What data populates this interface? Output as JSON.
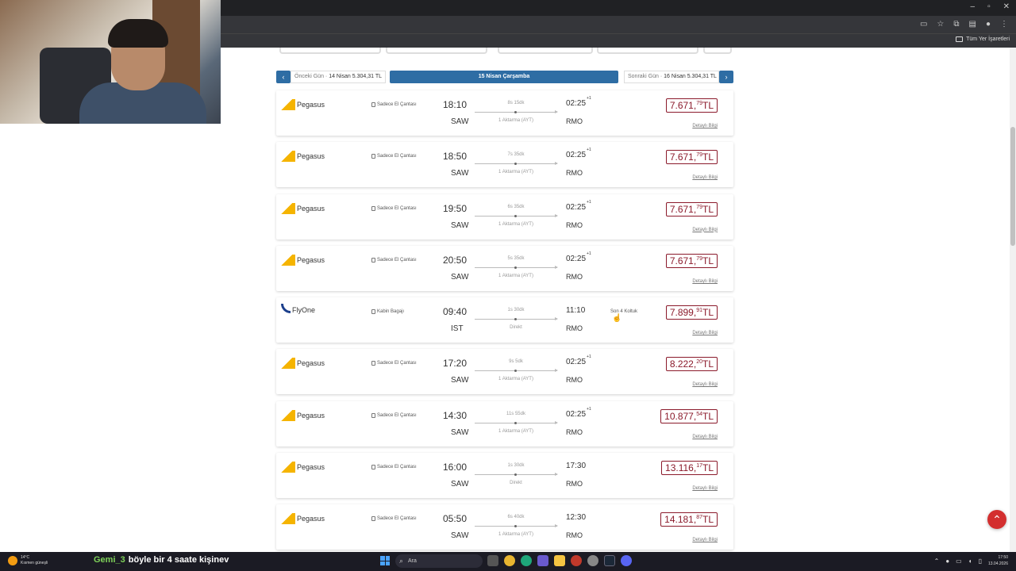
{
  "browser": {
    "bookmarks_all_label": "Tüm Yer İşaretleri"
  },
  "date_nav": {
    "prev_label": "Önceki Gün · ",
    "prev_value": "14 Nisan 5.304,31 TL",
    "current": "15 Nisan Çarşamba",
    "next_label": "Sonraki Gün · ",
    "next_value": "16 Nisan 5.304,31 TL",
    "prev_arrow": "‹",
    "next_arrow": "›"
  },
  "flights": [
    {
      "airline": "Pegasus",
      "logo": "pegasus-logo",
      "baggage": "Sadece El Çantası",
      "dep_time": "18:10",
      "dep_airport": "SAW",
      "duration": "8s 15dk",
      "stops": "1 Aktarma (AYT)",
      "arr_time": "02:25",
      "arr_plus": "+1",
      "arr_airport": "RMO",
      "seats": "",
      "price_main": "7.671,",
      "price_cents": "79",
      "currency": "TL",
      "details": "Detaylı Bilgi"
    },
    {
      "airline": "Pegasus",
      "logo": "pegasus-logo",
      "baggage": "Sadece El Çantası",
      "dep_time": "18:50",
      "dep_airport": "SAW",
      "duration": "7s 35dk",
      "stops": "1 Aktarma (AYT)",
      "arr_time": "02:25",
      "arr_plus": "+1",
      "arr_airport": "RMO",
      "seats": "",
      "price_main": "7.671,",
      "price_cents": "79",
      "currency": "TL",
      "details": "Detaylı Bilgi"
    },
    {
      "airline": "Pegasus",
      "logo": "pegasus-logo",
      "baggage": "Sadece El Çantası",
      "dep_time": "19:50",
      "dep_airport": "SAW",
      "duration": "6s 35dk",
      "stops": "1 Aktarma (AYT)",
      "arr_time": "02:25",
      "arr_plus": "+1",
      "arr_airport": "RMO",
      "seats": "",
      "price_main": "7.671,",
      "price_cents": "79",
      "currency": "TL",
      "details": "Detaylı Bilgi"
    },
    {
      "airline": "Pegasus",
      "logo": "pegasus-logo",
      "baggage": "Sadece El Çantası",
      "dep_time": "20:50",
      "dep_airport": "SAW",
      "duration": "5s 35dk",
      "stops": "1 Aktarma (AYT)",
      "arr_time": "02:25",
      "arr_plus": "+1",
      "arr_airport": "RMO",
      "seats": "",
      "price_main": "7.671,",
      "price_cents": "79",
      "currency": "TL",
      "details": "Detaylı Bilgi"
    },
    {
      "airline": "FlyOne",
      "logo": "flyone-logo",
      "baggage": "Kabin Bagajı",
      "dep_time": "09:40",
      "dep_airport": "IST",
      "duration": "1s 30dk",
      "stops": "Direkt",
      "arr_time": "11:10",
      "arr_plus": "",
      "arr_airport": "RMO",
      "seats": "Son 4 Koltuk",
      "price_main": "7.899,",
      "price_cents": "91",
      "currency": "TL",
      "details": "Detaylı Bilgi"
    },
    {
      "airline": "Pegasus",
      "logo": "pegasus-logo",
      "baggage": "Sadece El Çantası",
      "dep_time": "17:20",
      "dep_airport": "SAW",
      "duration": "9s 5dk",
      "stops": "1 Aktarma (AYT)",
      "arr_time": "02:25",
      "arr_plus": "+1",
      "arr_airport": "RMO",
      "seats": "",
      "price_main": "8.222,",
      "price_cents": "20",
      "currency": "TL",
      "details": "Detaylı Bilgi"
    },
    {
      "airline": "Pegasus",
      "logo": "pegasus-logo",
      "baggage": "Sadece El Çantası",
      "dep_time": "14:30",
      "dep_airport": "SAW",
      "duration": "11s 55dk",
      "stops": "1 Aktarma (AYT)",
      "arr_time": "02:25",
      "arr_plus": "+1",
      "arr_airport": "RMO",
      "seats": "",
      "price_main": "10.877,",
      "price_cents": "54",
      "currency": "TL",
      "details": "Detaylı Bilgi"
    },
    {
      "airline": "Pegasus",
      "logo": "pegasus-logo",
      "baggage": "Sadece El Çantası",
      "dep_time": "16:00",
      "dep_airport": "SAW",
      "duration": "1s 30dk",
      "stops": "Direkt",
      "arr_time": "17:30",
      "arr_plus": "",
      "arr_airport": "RMO",
      "seats": "",
      "price_main": "13.116,",
      "price_cents": "17",
      "currency": "TL",
      "details": "Detaylı Bilgi"
    },
    {
      "airline": "Pegasus",
      "logo": "pegasus-logo",
      "baggage": "Sadece El Çantası",
      "dep_time": "05:50",
      "dep_airport": "SAW",
      "duration": "6s 40dk",
      "stops": "1 Aktarma (AYT)",
      "arr_time": "12:30",
      "arr_plus": "",
      "arr_airport": "RMO",
      "seats": "",
      "price_main": "14.181,",
      "price_cents": "87",
      "currency": "TL",
      "details": "Detaylı Bilgi"
    }
  ],
  "taskbar": {
    "weather_temp": "14°C",
    "weather_desc": "Kısmen güneşli",
    "chat_user": "Gemi_3",
    "chat_message": "böyle bir 4 saate kişinev",
    "search_placeholder": "Ara",
    "time": "17:50",
    "date": "13.04.2026"
  },
  "colors": {
    "accent_blue": "#2e6da4",
    "price_red": "#8b1a2b",
    "back_to_top": "#d32f2f"
  }
}
